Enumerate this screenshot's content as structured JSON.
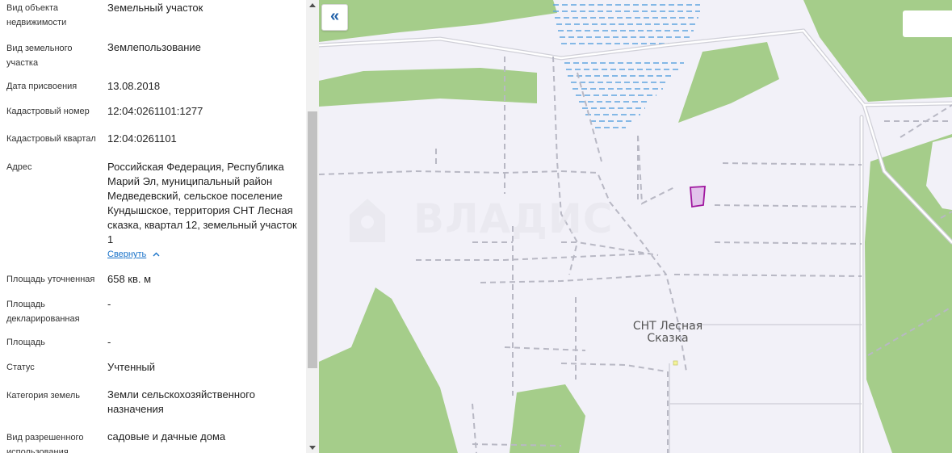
{
  "details": [
    {
      "label": "Вид объекта недвижимости",
      "value": "Земельный участок"
    },
    {
      "label": "Вид земельного участка",
      "value": "Землепользование"
    },
    {
      "label": "Дата присвоения",
      "value": "13.08.2018"
    },
    {
      "label": "Кадастровый номер",
      "value": "12:04:0261101:1277"
    },
    {
      "label": "Кадастровый квартал",
      "value": "12:04:0261101"
    },
    {
      "label": "Адрес",
      "value": "Российская Федерация, Республика Марий Эл, муниципальный район Медведевский, сельское поселение Кундышское, территория СНТ Лесная сказка, квартал 12, земельный участок 1"
    },
    {
      "label": "Площадь уточненная",
      "value": "658 кв. м"
    },
    {
      "label": "Площадь декларированная",
      "value": "-"
    },
    {
      "label": "Площадь",
      "value": "-"
    },
    {
      "label": "Статус",
      "value": "Учтенный"
    },
    {
      "label": "Категория земель",
      "value": "Земли сельскохозяйственного назначения"
    },
    {
      "label": "Вид разрешенного использования",
      "value": "садовые и дачные дома"
    }
  ],
  "address_collapse_label": "Свернуть",
  "map": {
    "back_button_label": "«",
    "place_label_line1": "СНТ Лесная",
    "place_label_line2": "Сказка",
    "watermark": "ВЛАДИС",
    "colors": {
      "background": "#f2f1f8",
      "forest": "#a5cd8a",
      "road": "#d0d0d8",
      "path": "#b8b8c4",
      "water": "#5fa6e0",
      "parcel_fill": "#e2c3eb",
      "parcel_stroke": "#a0179f"
    }
  }
}
